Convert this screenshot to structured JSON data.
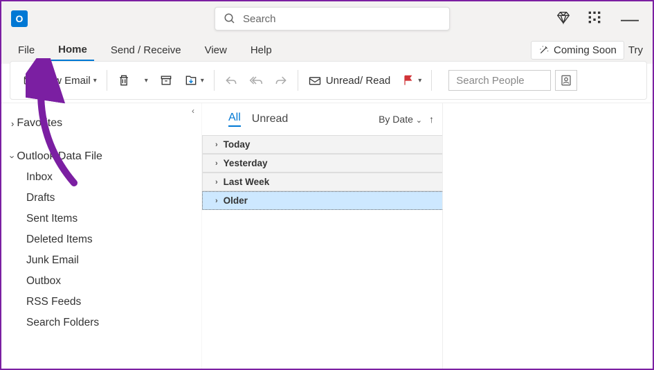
{
  "app": {
    "initial": "O"
  },
  "search": {
    "placeholder": "Search"
  },
  "tabs": {
    "file": "File",
    "home": "Home",
    "sendreceive": "Send / Receive",
    "view": "View",
    "help": "Help"
  },
  "ribbon_right": {
    "coming_soon": "Coming Soon",
    "try": "Try"
  },
  "toolbar": {
    "new_email": "New Email",
    "unread_read": "Unread/ Read",
    "search_people": "Search People"
  },
  "sidebar": {
    "favorites": "Favorites",
    "datafile": "Outlook Data File",
    "folders": {
      "inbox": "Inbox",
      "drafts": "Drafts",
      "sent": "Sent Items",
      "deleted": "Deleted Items",
      "junk": "Junk Email",
      "outbox": "Outbox",
      "rss": "RSS Feeds",
      "search": "Search Folders"
    }
  },
  "msglist": {
    "all": "All",
    "unread": "Unread",
    "sort": "By Date",
    "groups": {
      "today": "Today",
      "yesterday": "Yesterday",
      "lastweek": "Last Week",
      "older": "Older"
    }
  }
}
